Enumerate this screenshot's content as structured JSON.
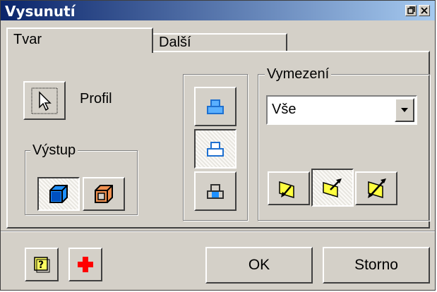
{
  "window": {
    "title": "Vysunutí"
  },
  "tabs": [
    {
      "label": "Tvar"
    },
    {
      "label": "Další"
    }
  ],
  "profile": {
    "label": "Profil"
  },
  "output_group": {
    "label": "Výstup",
    "buttons": [
      "solid-output-icon",
      "surface-output-icon"
    ],
    "selected": 0
  },
  "operation_buttons": [
    "join-icon",
    "cut-icon",
    "intersect-icon"
  ],
  "operation_selected": 1,
  "extents_group": {
    "label": "Vymezení",
    "selected_value": "Vše",
    "direction_selected": 1
  },
  "footer": {
    "ok_label": "OK",
    "cancel_label": "Storno"
  },
  "colors": {
    "title_start": "#0a246a",
    "title_end": "#a6caf0",
    "face": "#d4d0c8",
    "blue_accent": "#1e90ff",
    "orange_accent": "#e07030",
    "yellow_accent": "#ffff40",
    "red_accent": "#ff0000"
  }
}
